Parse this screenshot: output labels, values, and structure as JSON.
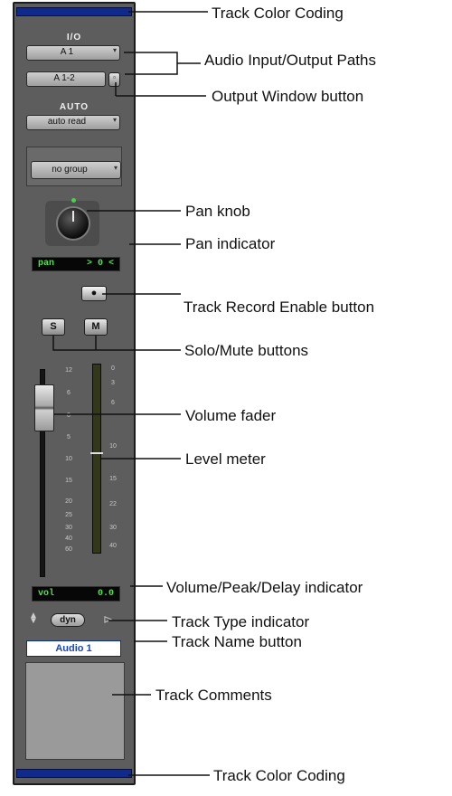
{
  "strip": {
    "io_label": "I/O",
    "input_path": "A 1",
    "output_path": "A 1-2",
    "auto_label": "AUTO",
    "automation_mode": "auto read",
    "group": "no group",
    "pan_display": {
      "label": "pan",
      "value": "> 0 <"
    },
    "record_symbol": "●",
    "solo_label": "S",
    "mute_label": "M",
    "fader_scale": [
      "12",
      "6",
      "0",
      "5",
      "10",
      "15",
      "20",
      "25",
      "30",
      "40",
      "60"
    ],
    "meter_scale": [
      "0",
      "3",
      "6",
      "10",
      "15",
      "22",
      "30",
      "40"
    ],
    "volume_display": {
      "label": "vol",
      "value": "0.0"
    },
    "track_type": "dyn",
    "track_name": "Audio 1",
    "colors": {
      "track_color": "#0f2a8c",
      "lcd_text": "#50e050",
      "name_text": "#1844c8"
    }
  },
  "callouts": {
    "track_color_top": "Track Color Coding",
    "io_paths": "Audio Input/Output Paths",
    "output_window": "Output Window button",
    "pan_knob": "Pan knob",
    "pan_indicator": "Pan indicator",
    "record_enable": "Track Record Enable button",
    "solo_mute": "Solo/Mute buttons",
    "volume_fader": "Volume fader",
    "level_meter": "Level meter",
    "volume_indicator": "Volume/Peak/Delay indicator",
    "track_type": "Track Type indicator",
    "track_name": "Track Name button",
    "track_comments": "Track Comments",
    "track_color_bottom": "Track Color Coding"
  }
}
